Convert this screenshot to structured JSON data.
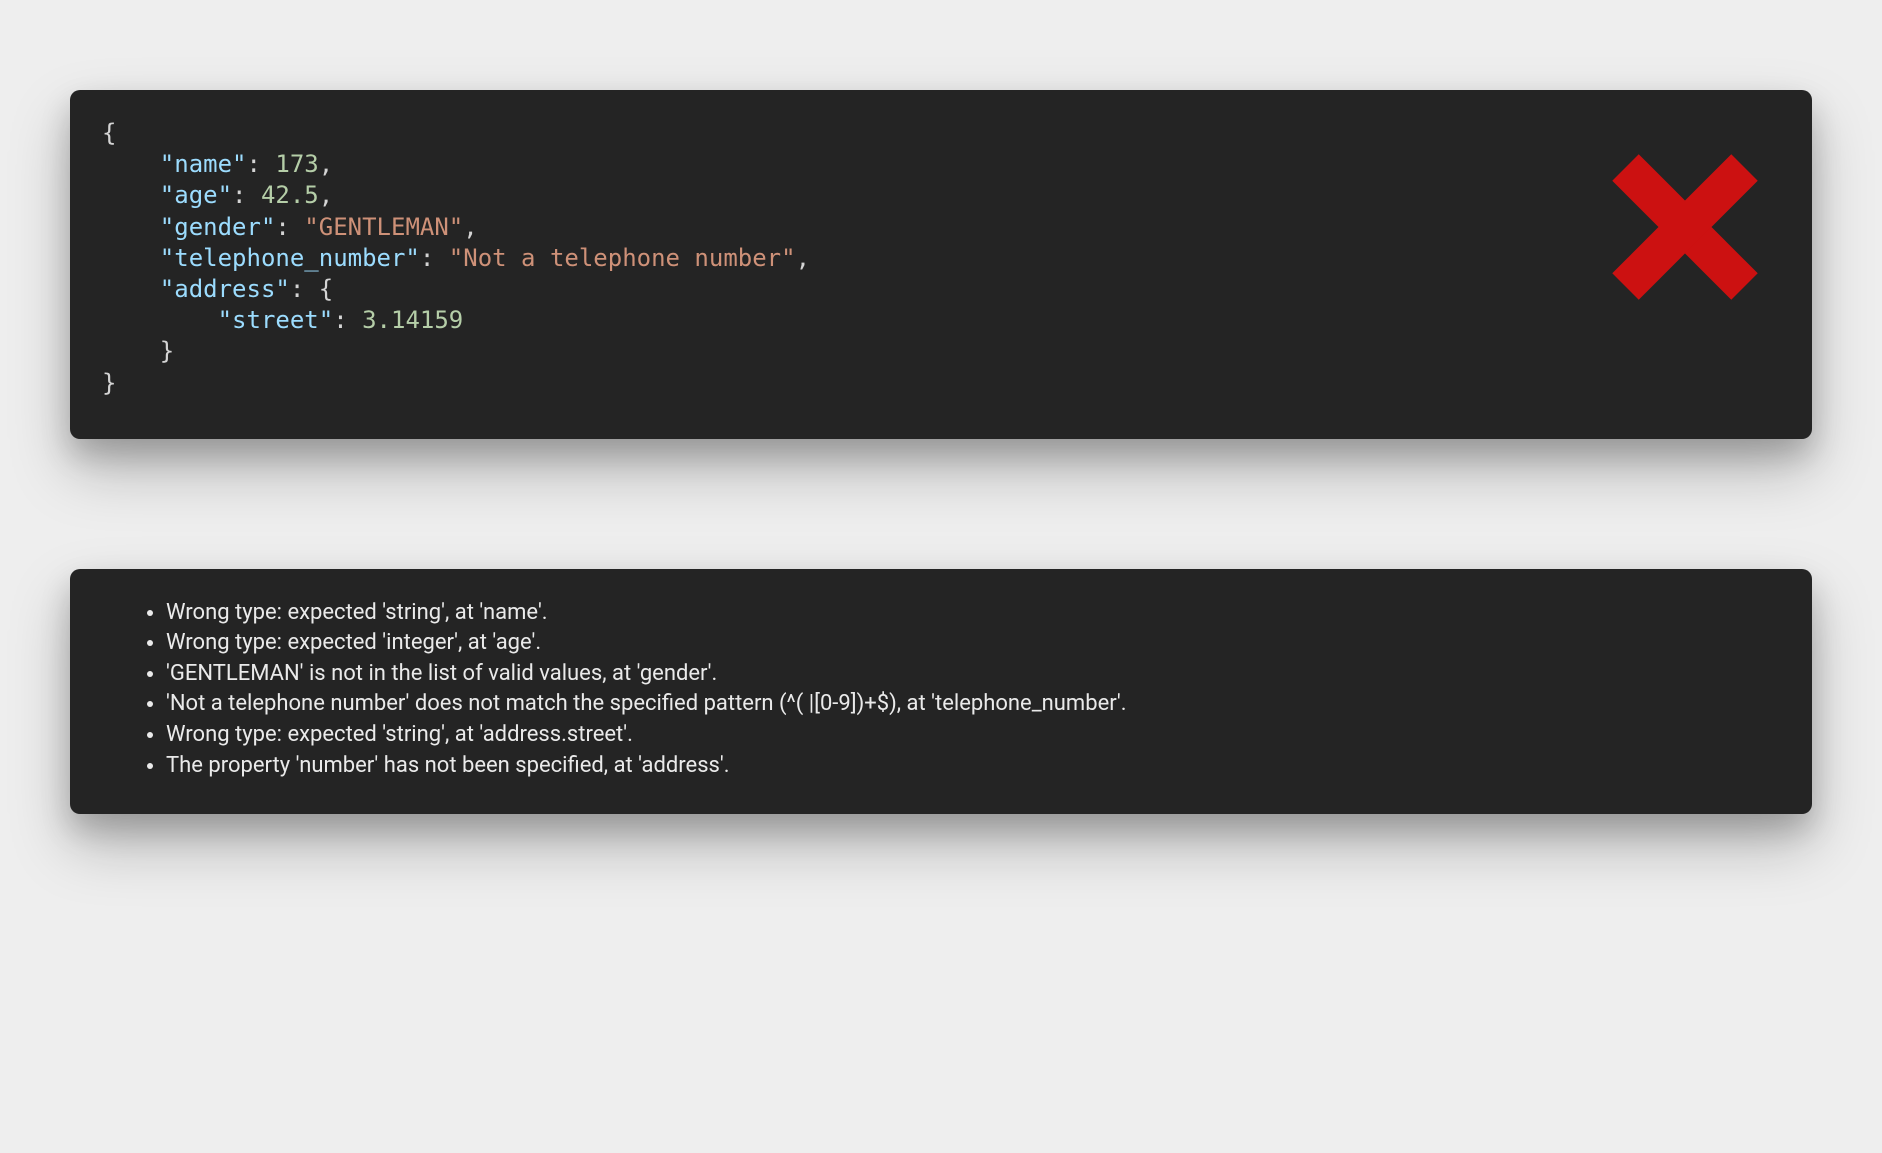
{
  "code": {
    "line1": "{",
    "key_name": "\"name\"",
    "val_name": "173",
    "key_age": "\"age\"",
    "val_age": "42.5",
    "key_gender": "\"gender\"",
    "val_gender": "\"GENTLEMAN\"",
    "key_tel": "\"telephone_number\"",
    "val_tel": "\"Not a telephone number\"",
    "key_address": "\"address\"",
    "punct_open_obj": "{",
    "key_street": "\"street\"",
    "val_street": "3.14159",
    "punct_close_inner": "}",
    "punct_close_outer": "}",
    "colon_sep": ": ",
    "comma": ","
  },
  "status": {
    "icon_name": "x-icon",
    "color": "#cc1111"
  },
  "errors": [
    "Wrong type: expected 'string', at 'name'.",
    "Wrong type: expected 'integer', at 'age'.",
    "'GENTLEMAN' is not in the list of valid values, at 'gender'.",
    "'Not a telephone number' does not match the specified pattern (^( |[0-9])+$), at 'telephone_number'.",
    "Wrong type: expected 'string', at 'address.street'.",
    "The property 'number' has not been specified, at 'address'."
  ]
}
